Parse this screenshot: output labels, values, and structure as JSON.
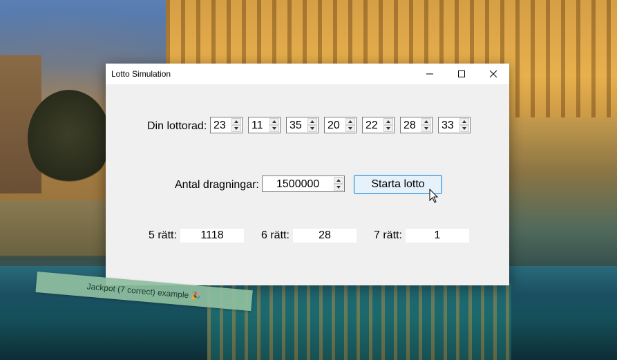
{
  "window": {
    "title": "Lotto Simulation"
  },
  "lottery_row": {
    "label": "Din lottorad:",
    "numbers": [
      "23",
      "11",
      "35",
      "20",
      "22",
      "28",
      "33"
    ]
  },
  "draws": {
    "label": "Antal dragningar:",
    "value": "1500000",
    "start_button": "Starta lotto"
  },
  "results": {
    "five": {
      "label": "5 rätt:",
      "value": "1118"
    },
    "six": {
      "label": "6 rätt:",
      "value": "28"
    },
    "seven": {
      "label": "7 rätt:",
      "value": "1"
    }
  },
  "caption": {
    "text": "Jackpot (7 correct) example 🎉"
  },
  "icons": [
    "minimize-icon",
    "maximize-icon",
    "close-icon",
    "spin-up-icon",
    "spin-down-icon",
    "mouse-pointer-icon"
  ],
  "colors": {
    "button_fill": "#e5f1fb",
    "button_border": "#0078d7",
    "caption_bg": "#8fbfa0"
  }
}
